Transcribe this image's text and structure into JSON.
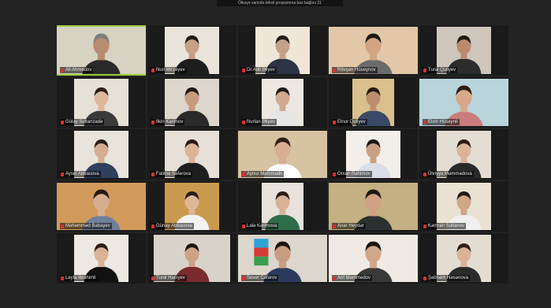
{
  "banner": {
    "text": "Ölkəyə xaricdə təhsil proqramına bax bağlını 21"
  },
  "participants": [
    {
      "name": "Ali Ahmedov",
      "bg": "#d8d2c2",
      "skin": "#b88c70",
      "shirt": "#2a2a2a",
      "hair": "#7d7d7d",
      "active": true,
      "layout": "full"
    },
    {
      "name": "Nuri Mirzəyev",
      "bg": "#e9e4da",
      "skin": "#c7a085",
      "shirt": "#1d1d1d",
      "hair": "#231b16",
      "active": false,
      "layout": "mid"
    },
    {
      "name": "Dr.Adil Əliyev",
      "bg": "#efe6d8",
      "skin": "#c4a08a",
      "shirt": "#2d3446",
      "hair": "#1f1a16",
      "active": false,
      "layout": "mid"
    },
    {
      "name": "Rövşən Hüseynov",
      "bg": "#e2c7a8",
      "skin": "#d1a583",
      "shirt": "#6c6c6c",
      "hair": "#1f1914",
      "active": false,
      "layout": "full"
    },
    {
      "name": "Tural Quliyev",
      "bg": "#cfc6bb",
      "skin": "#b98a6d",
      "shirt": "#2c2c2c",
      "hair": "#1c1814",
      "active": false,
      "layout": "mid"
    },
    {
      "name": "Gülay Sultanzadə",
      "bg": "#e6e1d7",
      "skin": "#dcb89b",
      "shirt": "#3b3b3b",
      "hair": "#2a1d15",
      "active": false,
      "layout": "mid"
    },
    {
      "name": "Ilkin Kərimov",
      "bg": "#dcd6cc",
      "skin": "#c79b7e",
      "shirt": "#2a2a2a",
      "hair": "#1e1712",
      "active": false,
      "layout": "mid"
    },
    {
      "name": "Nurlan Əliyev",
      "bg": "#ece8e1",
      "skin": "#d1ab8f",
      "shirt": "#e6e6e6",
      "hair": "#1f1813",
      "active": false,
      "layout": "narrow"
    },
    {
      "name": "Elnur Quliyev",
      "bg": "#d9c08c",
      "skin": "#bb8f6e",
      "shirt": "#3a4a66",
      "hair": "#201812",
      "active": false,
      "layout": "narrow"
    },
    {
      "name": "Elvin Hüseynli",
      "bg": "#b9d4db",
      "skin": "#d7a988",
      "shirt": "#c87c7c",
      "hair": "#2a1d15",
      "active": false,
      "layout": "full"
    },
    {
      "name": "Aysel Abbasova",
      "bg": "#e8e4dc",
      "skin": "#d4ae92",
      "shirt": "#2f3f5e",
      "hair": "#2b1e16",
      "active": false,
      "layout": "mid"
    },
    {
      "name": "Fatimə Səfərova",
      "bg": "#e6e0d8",
      "skin": "#dcb399",
      "shirt": "#1e1e1e",
      "hair": "#2a1c14",
      "active": false,
      "layout": "mid"
    },
    {
      "name": "Aynur Məmmədli",
      "bg": "#d7c2a2",
      "skin": "#d8af92",
      "shirt": "#ffffff",
      "hair": "#2e2018",
      "active": false,
      "layout": "full"
    },
    {
      "name": "Orxan Rəhimov",
      "bg": "#f2efea",
      "skin": "#c9a083",
      "shirt": "#d9dee8",
      "hair": "#1d1612",
      "active": false,
      "layout": "mid"
    },
    {
      "name": "Ülviyyə Məmmədova",
      "bg": "#e4ddd3",
      "skin": "#d9b498",
      "shirt": "#2a2a2a",
      "hair": "#2b1c14",
      "active": false,
      "layout": "mid"
    },
    {
      "name": "Məhəmməd Babayev",
      "bg": "#d29a5a",
      "skin": "#d7ad8f",
      "shirt": "#6f7f9c",
      "hair": "#231a14",
      "active": false,
      "layout": "full"
    },
    {
      "name": "Günay Abbasova",
      "bg": "#c99a4e",
      "skin": "#dcb697",
      "shirt": "#f3f3f3",
      "hair": "#2a1c14",
      "active": false,
      "layout": "mid"
    },
    {
      "name": "Lalə Kərimova",
      "bg": "#e7e3dc",
      "skin": "#d8b295",
      "shirt": "#2e6e4a",
      "hair": "#2a1d15",
      "active": false,
      "layout": "narrow"
    },
    {
      "name": "Anar Heydər",
      "bg": "#c4b082",
      "skin": "#cfa283",
      "shirt": "#2d3030",
      "hair": "#1e1713",
      "active": false,
      "layout": "full"
    },
    {
      "name": "Kamran Sultanov",
      "bg": "#e9e2d2",
      "skin": "#d0a689",
      "shirt": "#f0f0f0",
      "hair": "#211913",
      "active": false,
      "layout": "mid"
    },
    {
      "name": "Leyla İbrahimli",
      "bg": "#ede8e1",
      "skin": "#d9b396",
      "shirt": "#111111",
      "hair": "#2b1d15",
      "active": false,
      "layout": "mid"
    },
    {
      "name": "Tural Hacıyev",
      "bg": "#d8d3ca",
      "skin": "#cca185",
      "shirt": "#7a2c2c",
      "hair": "#1d1612",
      "active": false,
      "layout": "wide"
    },
    {
      "name": "Sevər Cəfərov",
      "bg": "#dcd6cc",
      "skin": "#c99d80",
      "shirt": "#2b3a5c",
      "hair": "#1c1511",
      "active": false,
      "layout": "full",
      "flag": true
    },
    {
      "name": "Arif Məmmədov",
      "bg": "#efebe4",
      "skin": "#d1a78a",
      "shirt": "#3a3a3a",
      "hair": "#1d1612",
      "active": false,
      "layout": "full"
    },
    {
      "name": "Şəbnəm Həsənova",
      "bg": "#e3dcd1",
      "skin": "#d9b397",
      "shirt": "#2b2b2b",
      "hair": "#2d1f17",
      "active": false,
      "layout": "mid"
    }
  ]
}
